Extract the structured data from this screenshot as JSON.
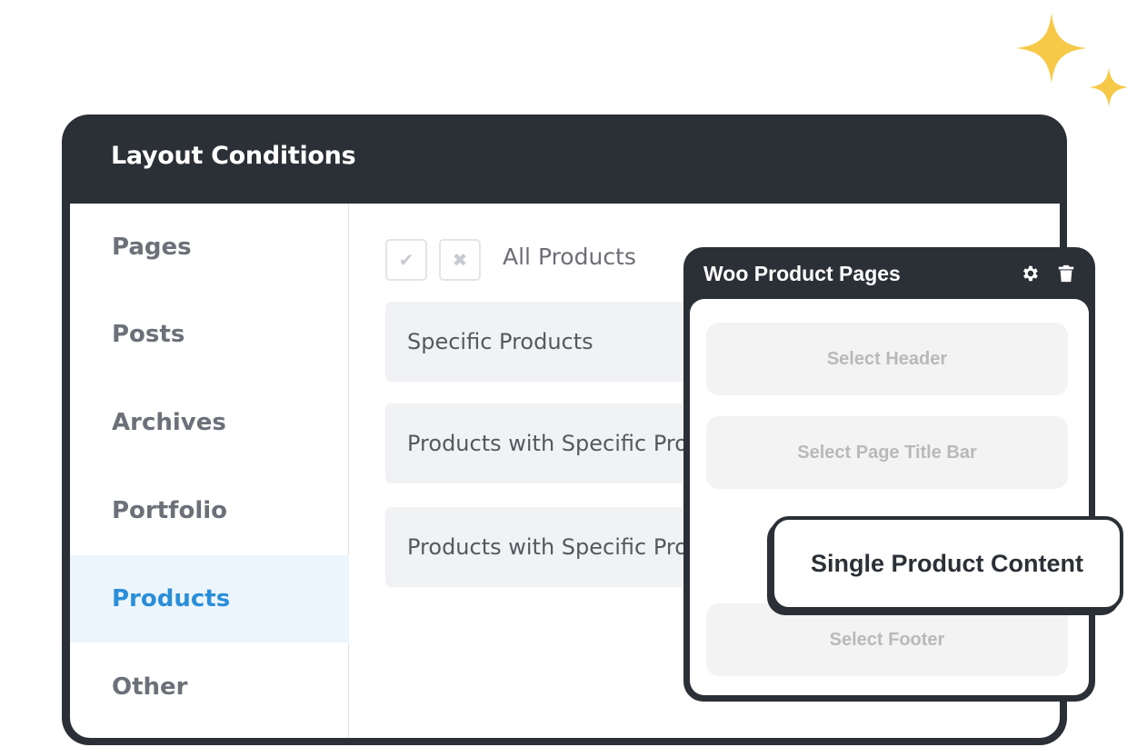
{
  "colors": {
    "dark": "#2b2f36",
    "accent": "#2a8fd8",
    "active_bg": "#edf5fc",
    "sparkle": "#f7c948"
  },
  "window": {
    "title": "Layout Conditions"
  },
  "sidebar": {
    "items": [
      {
        "label": "Pages",
        "active": false
      },
      {
        "label": "Posts",
        "active": false
      },
      {
        "label": "Archives",
        "active": false
      },
      {
        "label": "Portfolio",
        "active": false
      },
      {
        "label": "Products",
        "active": true
      },
      {
        "label": "Other",
        "active": false
      }
    ]
  },
  "content": {
    "include_icon": "check-icon",
    "exclude_icon": "x-icon",
    "all_label": "All Products",
    "rows": [
      {
        "label": "Specific Products"
      },
      {
        "label": "Products with Specific Product Categories"
      },
      {
        "label": "Products with Specific Product Tags"
      }
    ]
  },
  "woo_panel": {
    "title": "Woo Product Pages",
    "icons": [
      "gear-icon",
      "trash-icon"
    ],
    "selects": [
      {
        "label": "Select Header"
      },
      {
        "label": "Select Page Title Bar"
      },
      {
        "label": "Select Footer"
      }
    ]
  },
  "floating_card": {
    "label": "Single Product Content"
  }
}
